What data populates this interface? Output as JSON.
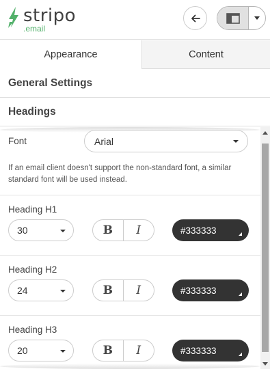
{
  "brand": {
    "name": "stripo",
    "suffix": ".email",
    "accent_color": "#53b16b"
  },
  "header": {
    "back_icon": "arrow-left-icon",
    "layout_icon": "layout-panel-icon",
    "dropdown_icon": "caret-down-icon"
  },
  "tabs": [
    {
      "label": "Appearance",
      "active": true
    },
    {
      "label": "Content",
      "active": false
    }
  ],
  "sections": {
    "general": "General Settings",
    "headings": "Headings"
  },
  "font_setting": {
    "label": "Font",
    "value": "Arial",
    "hint": "If an email client doesn't support the non-standard font, a similar standard font will be used instead."
  },
  "headings": [
    {
      "label": "Heading H1",
      "size": "30",
      "bold_label": "B",
      "italic_label": "I",
      "color": "#333333"
    },
    {
      "label": "Heading H2",
      "size": "24",
      "bold_label": "B",
      "italic_label": "I",
      "color": "#333333"
    },
    {
      "label": "Heading H3",
      "size": "20",
      "bold_label": "B",
      "italic_label": "I",
      "color": "#333333"
    }
  ],
  "colors": {
    "color_picker_bg": "#333333",
    "inactive_tab_bg": "#f4f4f4"
  }
}
